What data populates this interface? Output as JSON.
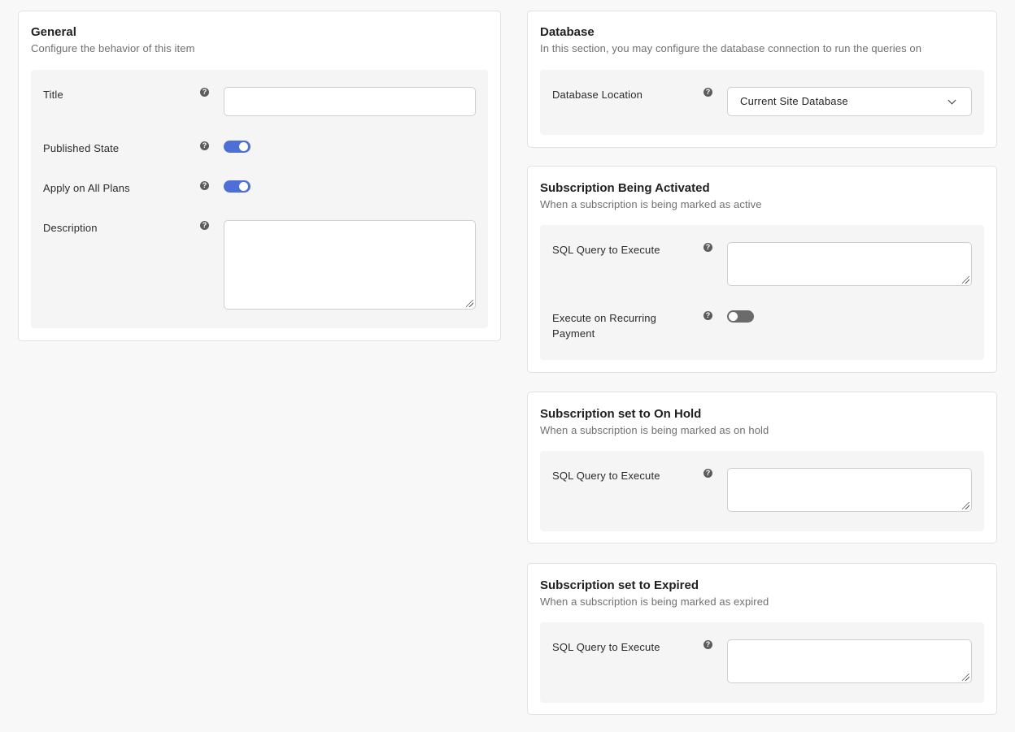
{
  "general": {
    "title": "General",
    "description": "Configure the behavior of this item",
    "fields": {
      "title": {
        "label": "Title",
        "value": "",
        "placeholder": ""
      },
      "published_state": {
        "label": "Published State",
        "on": true
      },
      "apply_all_plans": {
        "label": "Apply on All Plans",
        "on": true
      },
      "description": {
        "label": "Description",
        "value": ""
      }
    }
  },
  "database": {
    "title": "Database",
    "description": "In this section, you may configure the database connection to run the queries on",
    "location": {
      "label": "Database Location",
      "value": "Current Site Database"
    }
  },
  "activated": {
    "title": "Subscription Being Activated",
    "description": "When a subscription is being marked as active",
    "sql": {
      "label": "SQL Query to Execute",
      "value": ""
    },
    "recurring": {
      "label": "Execute on Recurring Payment",
      "on": false
    }
  },
  "on_hold": {
    "title": "Subscription set to On Hold",
    "description": "When a subscription is being marked as on hold",
    "sql": {
      "label": "SQL Query to Execute",
      "value": ""
    }
  },
  "expired": {
    "title": "Subscription set to Expired",
    "description": "When a subscription is being marked as expired",
    "sql": {
      "label": "SQL Query to Execute",
      "value": ""
    }
  },
  "icons": {
    "help": "question-circle-icon",
    "chevron": "chevron-down-icon",
    "resize": "resize-grip-icon"
  },
  "colors": {
    "toggle_on": "#4d6fd6",
    "toggle_off": "#6b6b6b",
    "background": "#f8f8f8"
  }
}
